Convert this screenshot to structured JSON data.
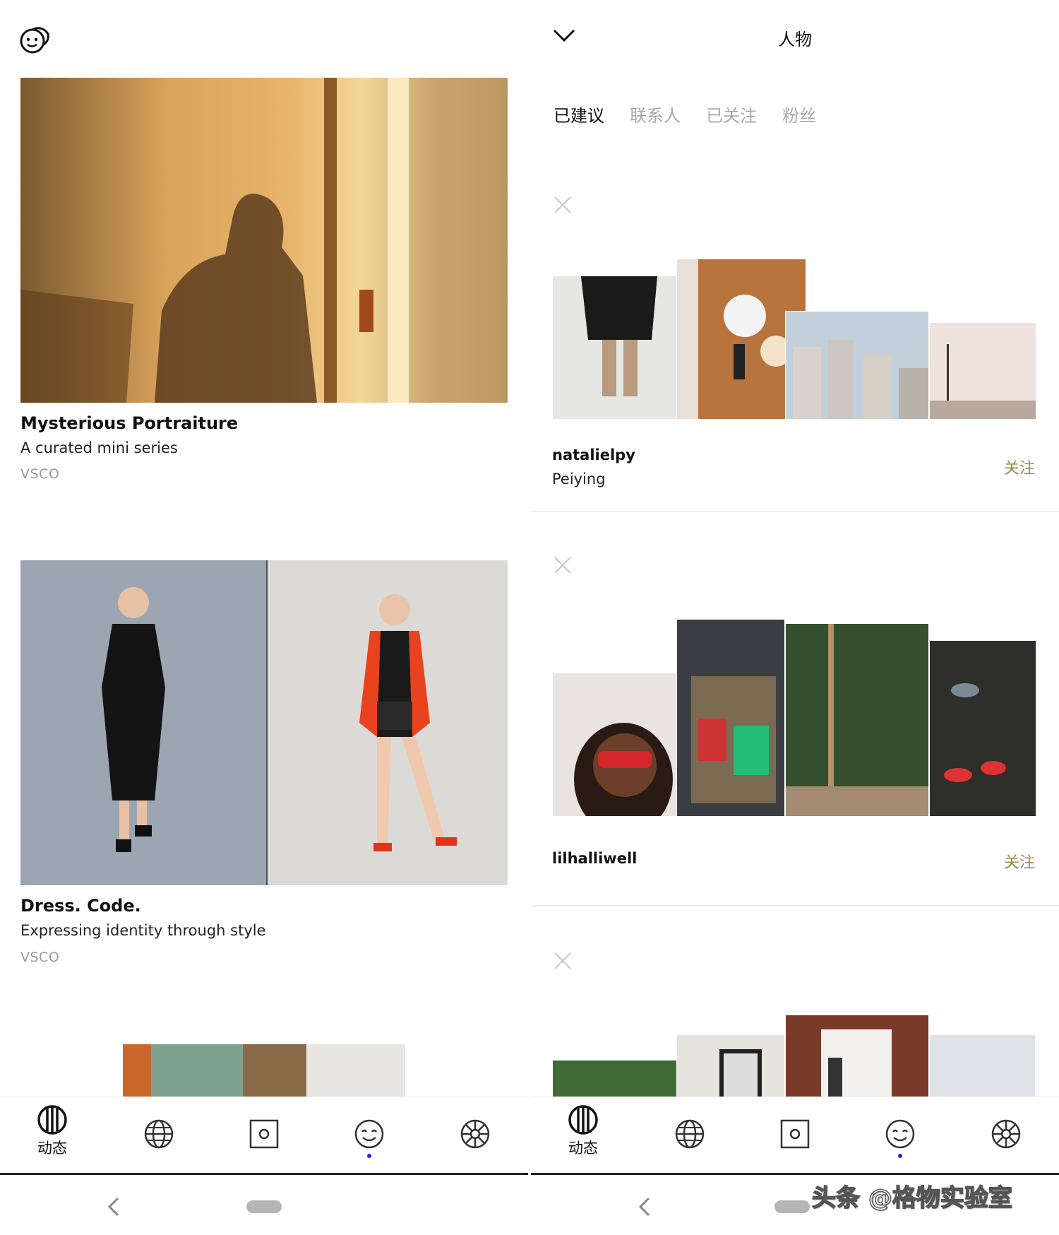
{
  "left": {
    "cards": [
      {
        "title": "Mysterious Portraiture",
        "subtitle": "A curated mini series",
        "source": "VSCO"
      },
      {
        "title": "Dress. Code.",
        "subtitle": "Expressing identity through style",
        "source": "VSCO"
      }
    ]
  },
  "right": {
    "title": "人物",
    "tabs": [
      {
        "label": "已建议",
        "active": true
      },
      {
        "label": "联系人",
        "active": false
      },
      {
        "label": "已关注",
        "active": false
      },
      {
        "label": "粉丝",
        "active": false
      }
    ],
    "people": [
      {
        "username": "natalielpy",
        "real_name": "Peiying",
        "follow_label": "关注"
      },
      {
        "username": "lilhalliwell",
        "real_name": "",
        "follow_label": "关注"
      }
    ]
  },
  "nav": {
    "items": [
      {
        "icon": "feed-icon",
        "label": "动态"
      },
      {
        "icon": "globe-icon",
        "label": ""
      },
      {
        "icon": "studio-icon",
        "label": ""
      },
      {
        "icon": "profile-face-icon",
        "label": ""
      },
      {
        "icon": "settings-wheel-icon",
        "label": ""
      }
    ]
  },
  "watermark": "头条 @格物实验室",
  "colors": {
    "follow": "#a08a48",
    "active_dot": "#1a2bd6",
    "inactive_tab": "#a8a8a8"
  }
}
